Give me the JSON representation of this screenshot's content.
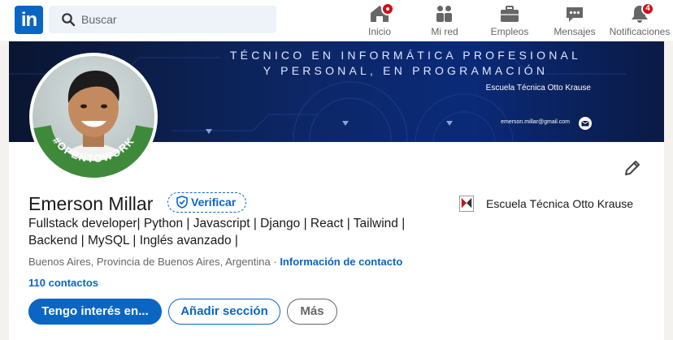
{
  "nav": {
    "logo_text": "in",
    "search_placeholder": "Buscar",
    "items": [
      {
        "label": "Inicio",
        "icon": "home-icon",
        "badge": ""
      },
      {
        "label": "Mi red",
        "icon": "network-icon",
        "badge": ""
      },
      {
        "label": "Empleos",
        "icon": "briefcase-icon",
        "badge": ""
      },
      {
        "label": "Mensajes",
        "icon": "messaging-icon",
        "badge": ""
      },
      {
        "label": "Notificaciones",
        "icon": "bell-icon",
        "badge": "4"
      }
    ]
  },
  "banner": {
    "line1": "TÉCNICO EN INFORMÁTICA PROFESIONAL",
    "line2": "Y PERSONAL, EN PROGRAMACIÓN",
    "school": "Escuela Técnica Otto Krause",
    "email": "emerson.millar@gmail.com"
  },
  "avatar": {
    "frame_text": "#OPENTOWORK",
    "frame_color": "#3f8a3a"
  },
  "profile": {
    "name": "Emerson Millar",
    "verify_label": "Verificar",
    "headline": "Fullstack developer| Python | Javascript | Django | React | Tailwind | Backend | MySQL | Inglés avanzado |",
    "location": "Buenos Aires, Provincia de Buenos Aires, Argentina",
    "separator": " · ",
    "contact_info_label": "Información de contacto",
    "connections": "110 contactos"
  },
  "education": {
    "name": "Escuela Técnica Otto Krause"
  },
  "actions": {
    "primary": "Tengo interés en...",
    "secondary": "Añadir sección",
    "more": "Más"
  },
  "colors": {
    "accent": "#0a66c2",
    "badge": "#cc1016",
    "open_to_work": "#3f8a3a"
  }
}
